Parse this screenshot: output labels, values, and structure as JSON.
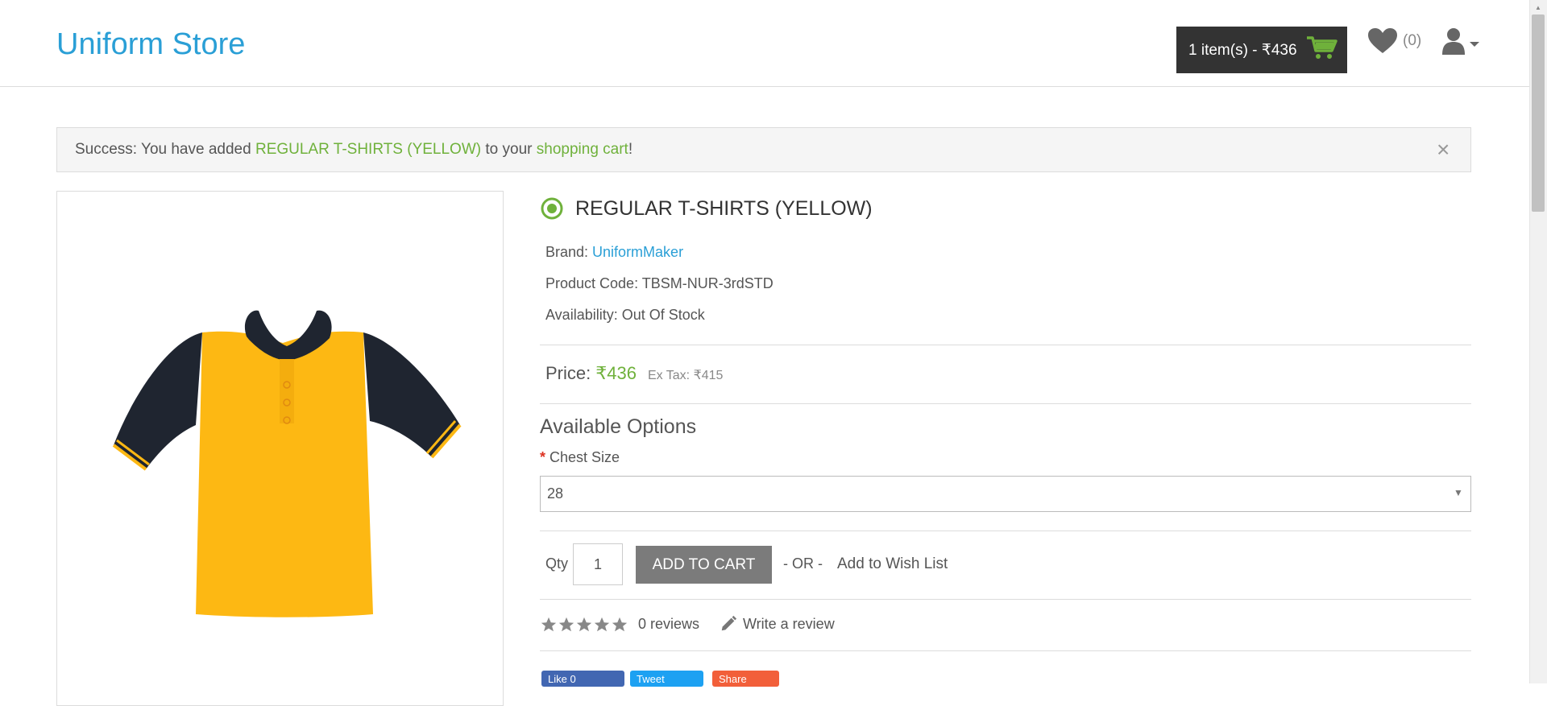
{
  "header": {
    "store_name": "Uniform Store",
    "cart_label": "1 item(s) - ₹436",
    "wishlist_count": "(0)"
  },
  "alert": {
    "prefix": "Success: You have added ",
    "product_link": "REGULAR T-SHIRTS (YELLOW)",
    "middle": " to your ",
    "cart_link": "shopping cart",
    "suffix": "!",
    "close": "×"
  },
  "product": {
    "title": "REGULAR T-SHIRTS (YELLOW)",
    "brand_label": "Brand: ",
    "brand": "UniformMaker",
    "code_label": "Product Code: ",
    "code": "TBSM-NUR-3rdSTD",
    "availability_label": "Availability: ",
    "availability": "Out Of Stock",
    "price_label": "Price:",
    "price": "₹436",
    "ex_tax": "Ex Tax: ₹415"
  },
  "options": {
    "heading": "Available Options",
    "chest_label": "Chest Size",
    "required_mark": "*",
    "chest_selected": "28"
  },
  "purchase": {
    "qty_label": "Qty",
    "qty_value": "1",
    "add_to_cart": "ADD TO CART",
    "or": "- OR -",
    "add_to_wishlist": "Add to Wish List"
  },
  "reviews": {
    "rating": 0,
    "count_label": "0 reviews",
    "write_label": "Write a review"
  },
  "social": {
    "like": "Like 0",
    "tweet": "Tweet",
    "share": "Share"
  },
  "colors": {
    "brand_blue": "#2a9fd6",
    "accent_green": "#6fb13b",
    "cart_dark": "#333333",
    "shirt_yellow": "#fdb813",
    "shirt_navy": "#1f2530"
  }
}
